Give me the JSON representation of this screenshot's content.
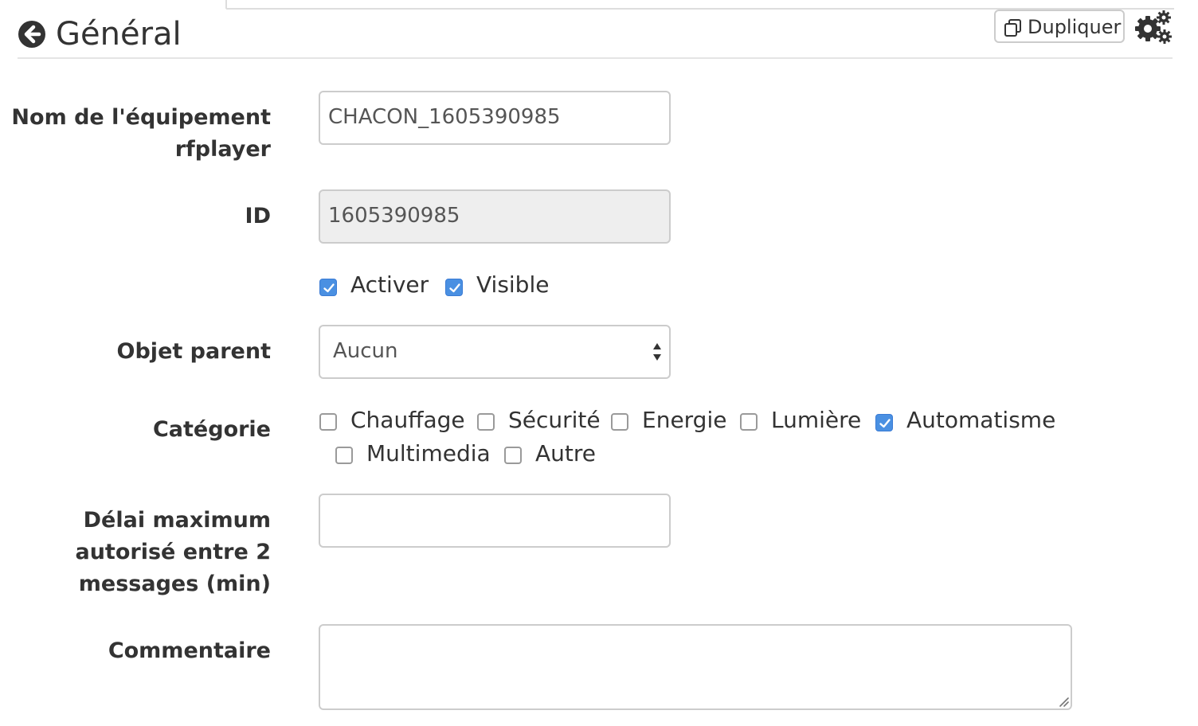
{
  "header": {
    "title": "Général",
    "duplicate_label": "Dupliquer"
  },
  "form": {
    "name_label_line1": "Nom de l'équipement",
    "name_label_line2": "rfplayer",
    "name_value": "CHACON_1605390985",
    "id_label": "ID",
    "id_value": "1605390985",
    "enable_label": "Activer",
    "enable_checked": true,
    "visible_label": "Visible",
    "visible_checked": true,
    "parent_label": "Objet parent",
    "parent_value": "Aucun",
    "category_label": "Catégorie",
    "categories": [
      {
        "label": "Chauffage",
        "checked": false
      },
      {
        "label": "Sécurité",
        "checked": false
      },
      {
        "label": "Energie",
        "checked": false
      },
      {
        "label": "Lumière",
        "checked": false
      },
      {
        "label": "Automatisme",
        "checked": true
      },
      {
        "label": "Multimedia",
        "checked": false
      },
      {
        "label": "Autre",
        "checked": false
      }
    ],
    "delay_label_line1": "Délai maximum",
    "delay_label_line2": "autorisé entre 2",
    "delay_label_line3": "messages (min)",
    "delay_value": "",
    "comment_label": "Commentaire",
    "comment_value": ""
  },
  "colors": {
    "checkbox_on": "#4a90e2",
    "border": "#cccccc",
    "readonly_bg": "#eeeeee"
  },
  "icons": [
    "back-arrow-icon",
    "copy-icon",
    "gears-icon",
    "check-icon",
    "select-arrows-icon",
    "resize-grip-icon"
  ]
}
